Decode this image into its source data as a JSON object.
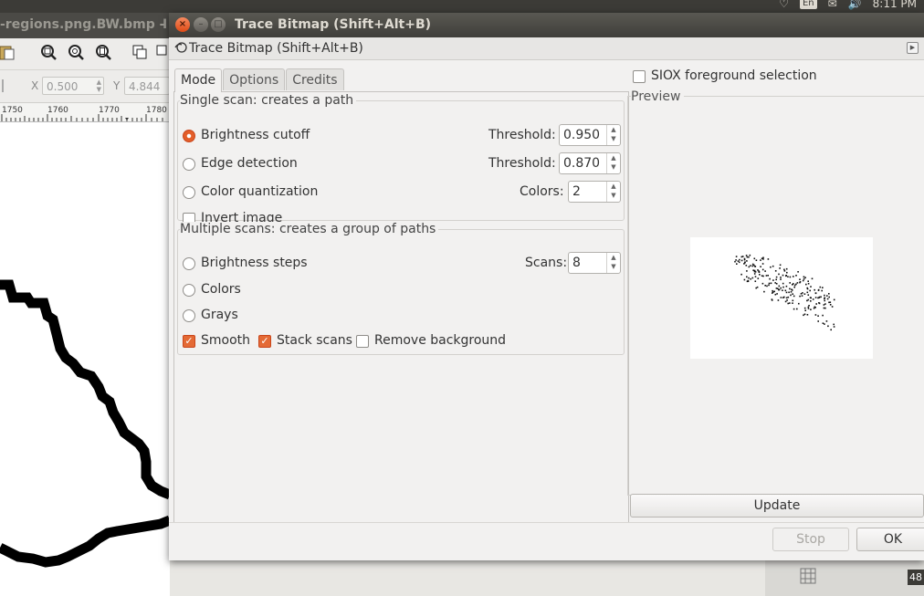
{
  "top_panel": {
    "lang": "En",
    "time": "8:11 PM"
  },
  "background_window": {
    "title": "-regions.png.BW.bmp -",
    "title_more": "I",
    "coords": {
      "x_label": "X",
      "x_value": "0.500",
      "y_label": "Y",
      "y_value": "4.844"
    },
    "ruler_ticks": [
      "1750",
      "1760",
      "1770",
      "1780"
    ],
    "status_number": "48"
  },
  "dialog": {
    "window_title": "Trace Bitmap (Shift+Alt+B)",
    "dock_title": "Trace Bitmap (Shift+Alt+B)",
    "tabs": [
      {
        "label": "Mode",
        "active": true
      },
      {
        "label": "Options",
        "active": false
      },
      {
        "label": "Credits",
        "active": false
      }
    ],
    "single_scan": {
      "title": "Single scan: creates a path",
      "brightness_cutoff": {
        "label": "Brightness cutoff",
        "selected": true,
        "param_label": "Threshold:",
        "value": "0.950"
      },
      "edge_detection": {
        "label": "Edge detection",
        "selected": false,
        "param_label": "Threshold:",
        "value": "0.870"
      },
      "color_quantization": {
        "label": "Color quantization",
        "selected": false,
        "param_label": "Colors:",
        "value": "2"
      },
      "invert_image": {
        "label": "Invert image",
        "checked": false
      }
    },
    "multiple_scans": {
      "title": "Multiple scans: creates a group of paths",
      "brightness_steps": {
        "label": "Brightness steps",
        "selected": false,
        "param_label": "Scans:",
        "value": "8"
      },
      "colors": {
        "label": "Colors",
        "selected": false
      },
      "grays": {
        "label": "Grays",
        "selected": false
      },
      "smooth": {
        "label": "Smooth",
        "checked": true
      },
      "stack_scans": {
        "label": "Stack scans",
        "checked": true
      },
      "remove_background": {
        "label": "Remove background",
        "checked": false
      }
    },
    "siox": {
      "label": "SIOX foreground selection",
      "checked": false
    },
    "preview": {
      "label": "Preview"
    },
    "buttons": {
      "update": "Update",
      "stop": "Stop",
      "ok": "OK"
    }
  },
  "colors": {
    "accent": "#e35e2a",
    "titlebar": "#3f3e3a",
    "dialog_bg": "#f2f1f0"
  }
}
